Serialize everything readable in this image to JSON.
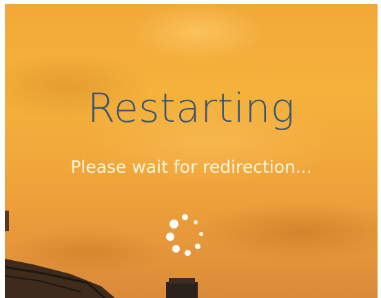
{
  "title": "Restarting",
  "message": "Please wait for redirection...",
  "spinner": {
    "icon": "loading-spinner-icon"
  },
  "colors": {
    "title": "#3b5672",
    "message": "#fff6df",
    "sky": "#f2a838"
  }
}
